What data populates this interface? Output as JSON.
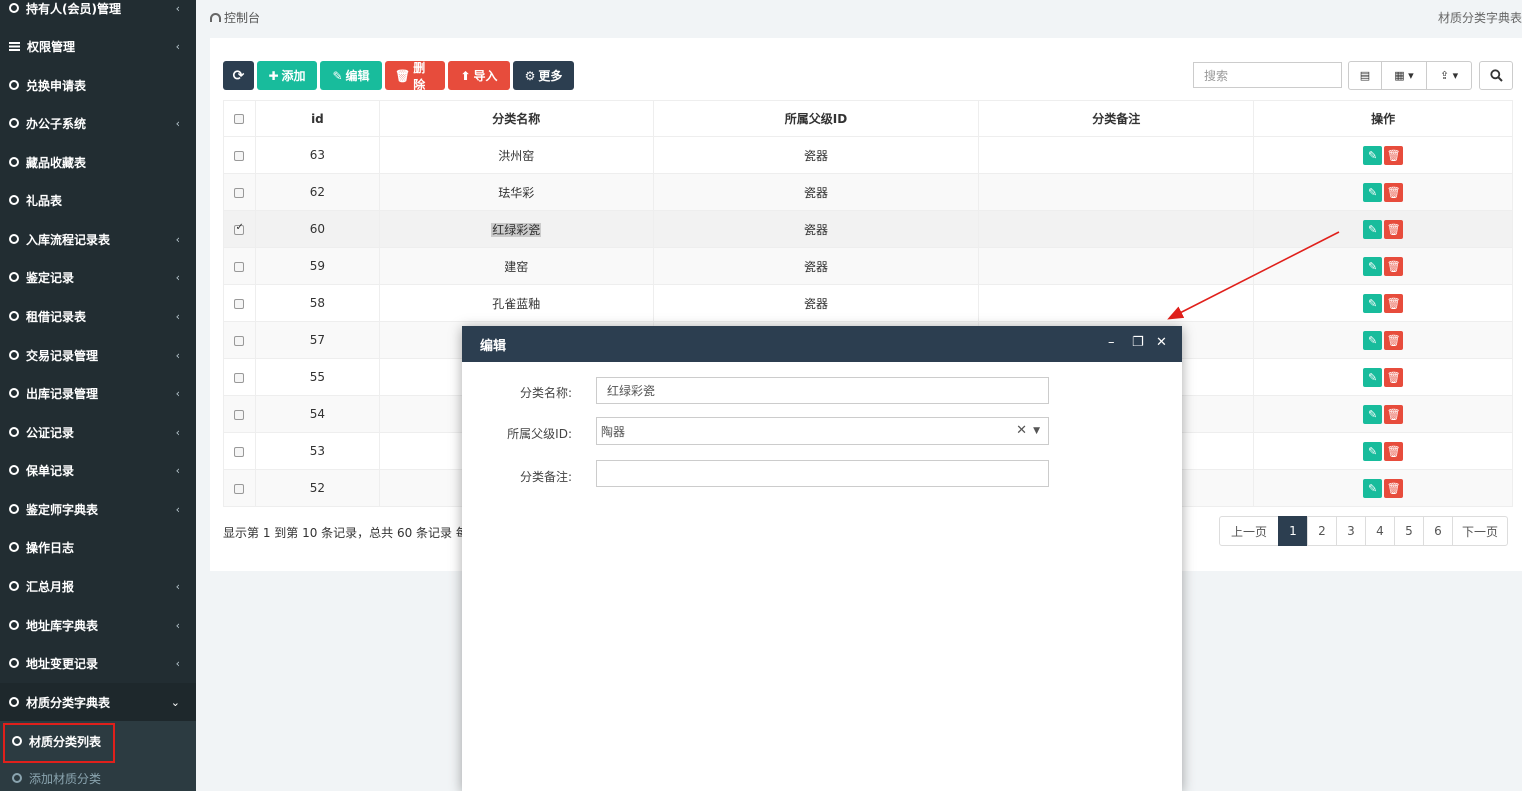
{
  "sidebar": {
    "items": [
      {
        "label": "持有人(会员)管理",
        "icon": "ring",
        "arrow": "‹"
      },
      {
        "label": "权限管理",
        "icon": "bars",
        "arrow": "‹"
      },
      {
        "label": "兑换申请表",
        "icon": "ring",
        "arrow": ""
      },
      {
        "label": "办公子系统",
        "icon": "ring",
        "arrow": "‹"
      },
      {
        "label": "藏品收藏表",
        "icon": "ring",
        "arrow": ""
      },
      {
        "label": "礼品表",
        "icon": "ring",
        "arrow": ""
      },
      {
        "label": "入库流程记录表",
        "icon": "ring",
        "arrow": "‹"
      },
      {
        "label": "鉴定记录",
        "icon": "ring",
        "arrow": "‹"
      },
      {
        "label": "租借记录表",
        "icon": "ring",
        "arrow": "‹"
      },
      {
        "label": "交易记录管理",
        "icon": "ring",
        "arrow": "‹"
      },
      {
        "label": "出库记录管理",
        "icon": "ring",
        "arrow": "‹"
      },
      {
        "label": "公证记录",
        "icon": "ring",
        "arrow": "‹"
      },
      {
        "label": "保单记录",
        "icon": "ring",
        "arrow": "‹"
      },
      {
        "label": "鉴定师字典表",
        "icon": "ring",
        "arrow": "‹"
      },
      {
        "label": "操作日志",
        "icon": "ring",
        "arrow": ""
      },
      {
        "label": "汇总月报",
        "icon": "ring",
        "arrow": "‹"
      },
      {
        "label": "地址库字典表",
        "icon": "ring",
        "arrow": "‹"
      },
      {
        "label": "地址变更记录",
        "icon": "ring",
        "arrow": "‹"
      },
      {
        "label": "材质分类字典表",
        "icon": "ring",
        "arrow": "⌄"
      }
    ],
    "sub_items": [
      {
        "label": "材质分类列表"
      },
      {
        "label": "添加材质分类"
      }
    ]
  },
  "breadcrumb": {
    "label": "控制台",
    "right": "材质分类字典表"
  },
  "toolbar": {
    "refresh": "⟳",
    "add": "添加",
    "edit": "编辑",
    "delete": "删除",
    "import": "导入",
    "more": "更多"
  },
  "search": {
    "placeholder": "搜索"
  },
  "table": {
    "headers": [
      "id",
      "分类名称",
      "所属父级ID",
      "分类备注",
      "操作"
    ],
    "rows": [
      {
        "id": "63",
        "name": "洪州窑",
        "parent": "瓷器",
        "note": "",
        "checked": false
      },
      {
        "id": "62",
        "name": "珐华彩",
        "parent": "瓷器",
        "note": "",
        "checked": false
      },
      {
        "id": "60",
        "name": "红绿彩瓷",
        "parent": "瓷器",
        "note": "",
        "checked": true
      },
      {
        "id": "59",
        "name": "建窑",
        "parent": "瓷器",
        "note": "",
        "checked": false
      },
      {
        "id": "58",
        "name": "孔雀蓝釉",
        "parent": "瓷器",
        "note": "",
        "checked": false
      },
      {
        "id": "57",
        "name": "",
        "parent": "",
        "note": "",
        "checked": false
      },
      {
        "id": "55",
        "name": "",
        "parent": "",
        "note": "",
        "checked": false
      },
      {
        "id": "54",
        "name": "",
        "parent": "",
        "note": "",
        "checked": false
      },
      {
        "id": "53",
        "name": "",
        "parent": "",
        "note": "",
        "checked": false
      },
      {
        "id": "52",
        "name": "",
        "parent": "",
        "note": "",
        "checked": false
      }
    ]
  },
  "summary": "显示第 1 到第 10 条记录，总共 60 条记录 每",
  "pagination": {
    "prev": "上一页",
    "pages": [
      "1",
      "2",
      "3",
      "4",
      "5",
      "6"
    ],
    "current": "1",
    "next": "下一页"
  },
  "modal": {
    "title": "编辑",
    "fields": {
      "name_label": "分类名称:",
      "name_value": "红绿彩瓷",
      "parent_label": "所属父级ID:",
      "parent_value": "陶器",
      "note_label": "分类备注:",
      "note_value": ""
    }
  },
  "colors": {
    "sidebar_bg": "#222d32",
    "header_dark": "#2c3e50",
    "success": "#18bc9c",
    "danger": "#e74c3c",
    "annotation_red": "#e0201b"
  }
}
